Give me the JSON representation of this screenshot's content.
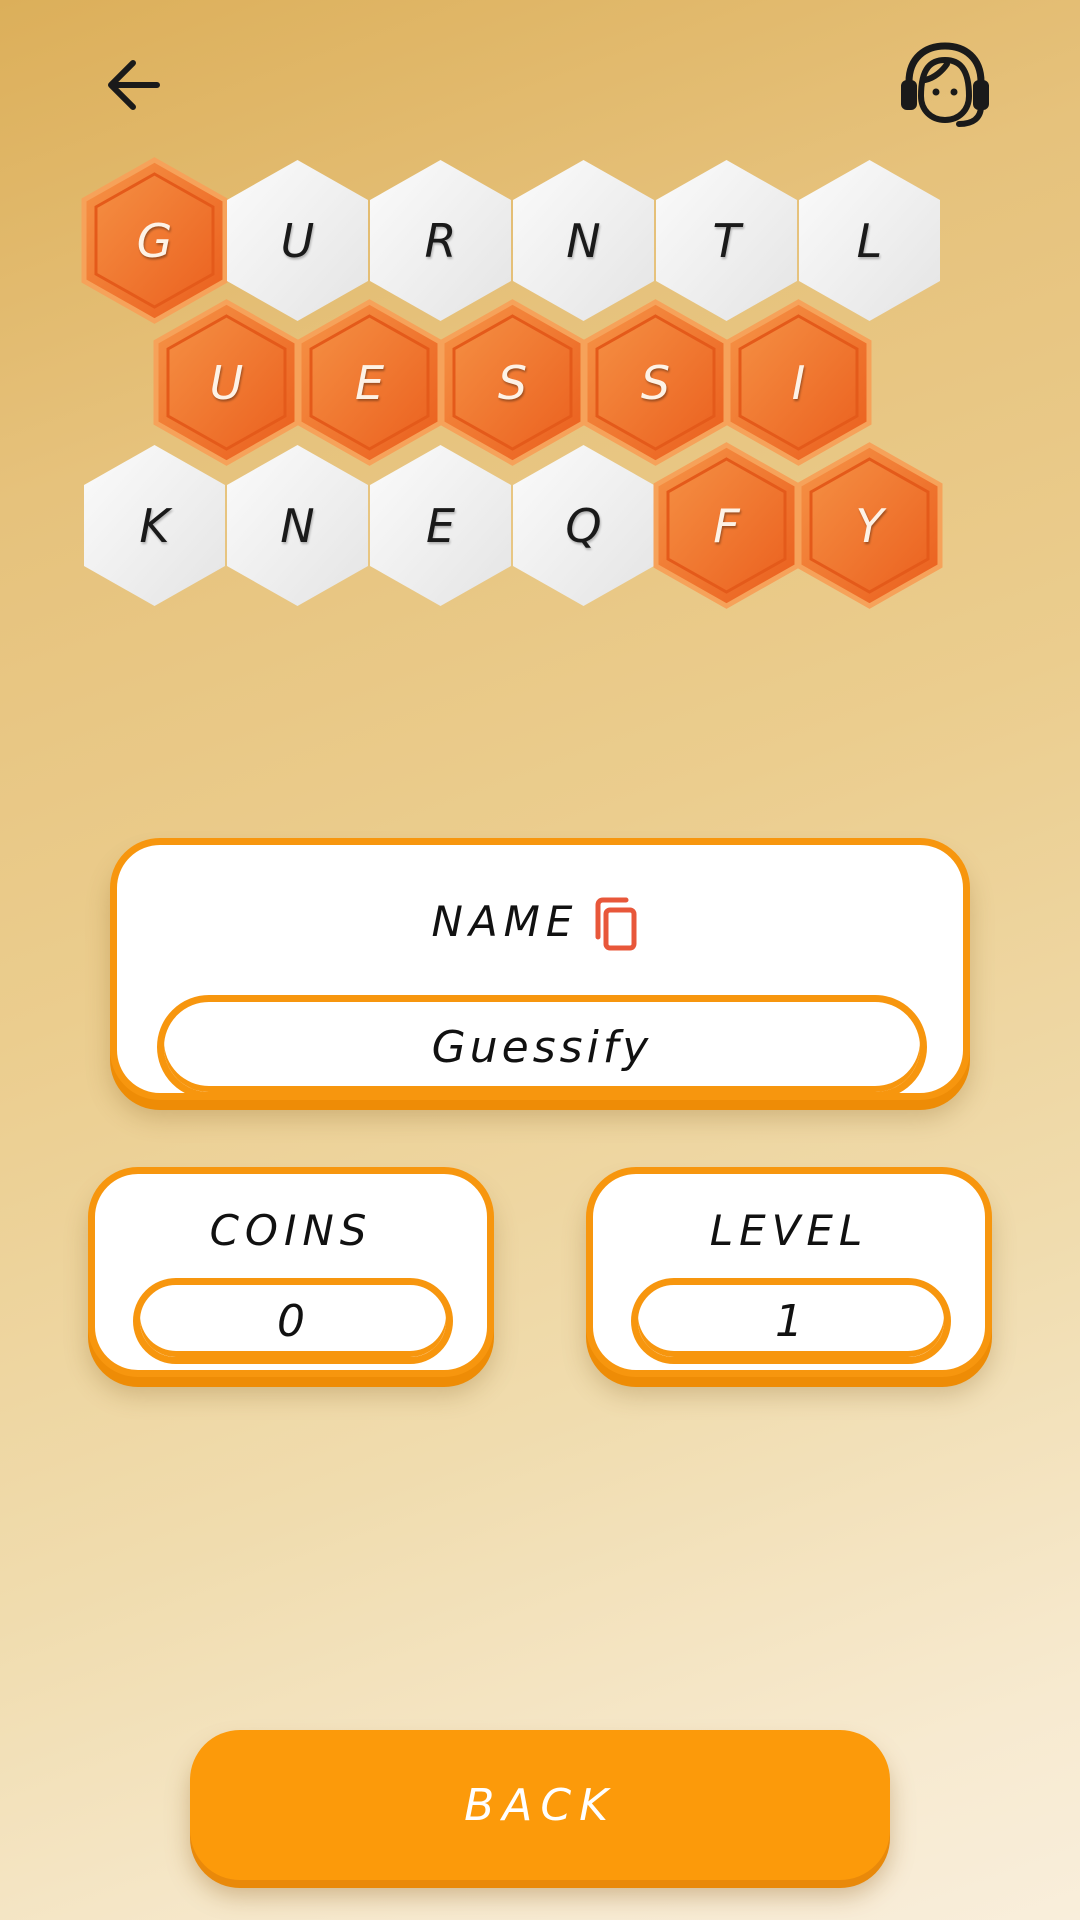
{
  "header": {
    "back_icon": "arrow-left-icon",
    "support_icon": "headset-support-icon"
  },
  "board": {
    "rows": [
      [
        {
          "letter": "G",
          "selected": true
        },
        {
          "letter": "U",
          "selected": false
        },
        {
          "letter": "R",
          "selected": false
        },
        {
          "letter": "N",
          "selected": false
        },
        {
          "letter": "T",
          "selected": false
        },
        {
          "letter": "L",
          "selected": false
        }
      ],
      [
        {
          "letter": "U",
          "selected": true
        },
        {
          "letter": "E",
          "selected": true
        },
        {
          "letter": "S",
          "selected": true
        },
        {
          "letter": "S",
          "selected": true
        },
        {
          "letter": "I",
          "selected": true
        }
      ],
      [
        {
          "letter": "K",
          "selected": false
        },
        {
          "letter": "N",
          "selected": false
        },
        {
          "letter": "E",
          "selected": false
        },
        {
          "letter": "Q",
          "selected": false
        },
        {
          "letter": "F",
          "selected": true
        },
        {
          "letter": "Y",
          "selected": true
        }
      ]
    ]
  },
  "profile": {
    "name_label": "NAME",
    "name_value": "Guessify",
    "copy_icon": "copy-icon",
    "coins_label": "COINS",
    "coins_value": "0",
    "level_label": "LEVEL",
    "level_value": "1"
  },
  "back_button_label": "BACK",
  "colors": {
    "accent": "#fc9a0a",
    "tile_selected": "#f07a26",
    "tile_unselected": "#f2f2f2",
    "copy_icon": "#e8573a"
  }
}
